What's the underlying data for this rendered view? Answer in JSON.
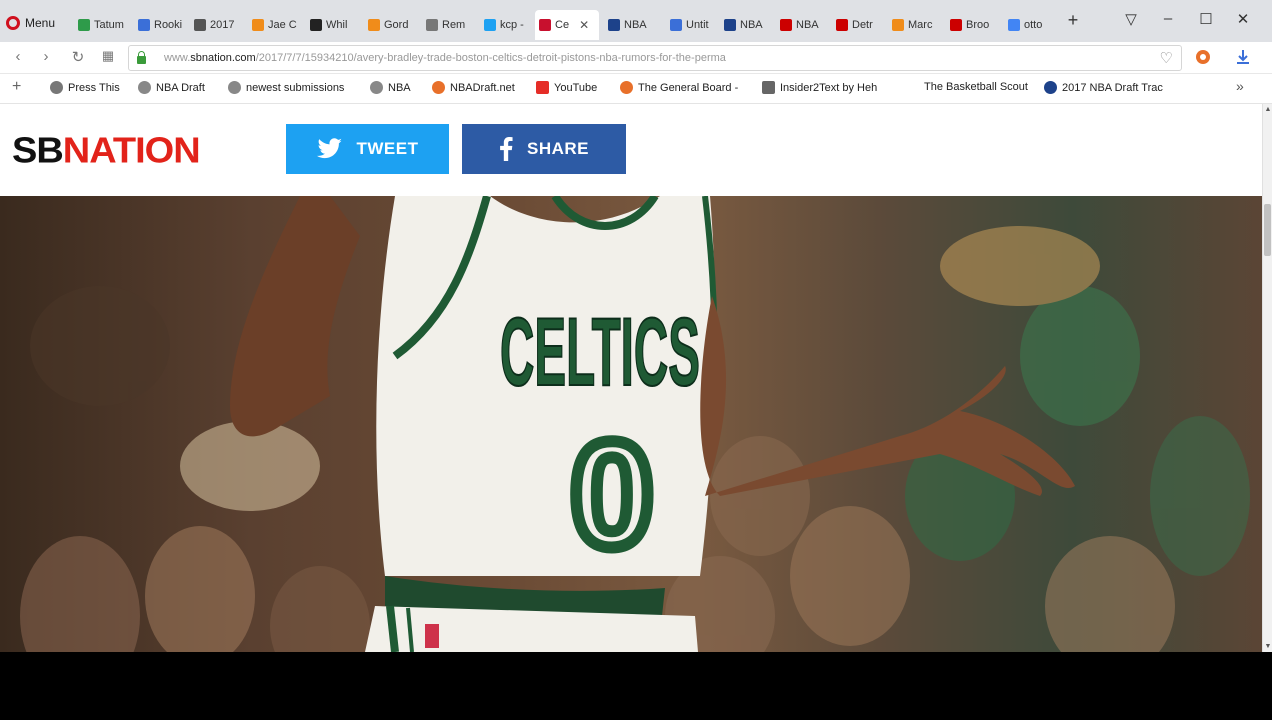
{
  "browser": {
    "menu_label": "Menu",
    "tabs": [
      {
        "label": "Tatum",
        "color": "#2e9b4a"
      },
      {
        "label": "Rooki",
        "color": "#3b6fd8"
      },
      {
        "label": "2017",
        "color": "#555555"
      },
      {
        "label": "Jae C",
        "color": "#f08c1a"
      },
      {
        "label": "Whil",
        "color": "#222222"
      },
      {
        "label": "Gord",
        "color": "#f08c1a"
      },
      {
        "label": "Rem",
        "color": "#777777"
      },
      {
        "label": "kcp -",
        "color": "#1da1f2"
      },
      {
        "label": "Ce",
        "color": "#c8102e",
        "active": true
      },
      {
        "label": "NBA",
        "color": "#1d428a"
      },
      {
        "label": "Untit",
        "color": "#3b6fd8"
      },
      {
        "label": "NBA",
        "color": "#1d428a"
      },
      {
        "label": "NBA",
        "color": "#cc0000"
      },
      {
        "label": "Detr",
        "color": "#cc0000"
      },
      {
        "label": "Marc",
        "color": "#f08c1a"
      },
      {
        "label": "Broo",
        "color": "#cc0000"
      },
      {
        "label": "otto",
        "color": "#4285f4"
      }
    ],
    "address_bar": {
      "url_prefix": "www.",
      "url_domain": "sbnation.com",
      "url_path": "/2017/7/7/15934210/avery-bradley-trade-boston-celtics-detroit-pistons-nba-rumors-for-the-perma"
    },
    "bookmarks": [
      {
        "label": "Press This",
        "icon": "star-bookmark-icon"
      },
      {
        "label": "NBA Draft",
        "icon": "reddit-icon"
      },
      {
        "label": "newest submissions",
        "icon": "reddit-icon"
      },
      {
        "label": "NBA",
        "icon": "reddit-icon"
      },
      {
        "label": "NBADraft.net",
        "icon": "basketball-icon"
      },
      {
        "label": "YouTube",
        "icon": "youtube-icon"
      },
      {
        "label": "The General Board -",
        "icon": "basketball-icon"
      },
      {
        "label": "Insider2Text by Heh",
        "icon": "page-icon"
      },
      {
        "label": "The Basketball Scout",
        "icon": ""
      },
      {
        "label": "2017 NBA Draft Trac",
        "icon": "globe-icon"
      }
    ]
  },
  "page": {
    "logo": {
      "part1": "SB",
      "part2": "NATION"
    },
    "tweet_label": "TWEET",
    "share_label": "SHARE",
    "jersey": {
      "team": "CELTICS",
      "number": "0"
    }
  }
}
